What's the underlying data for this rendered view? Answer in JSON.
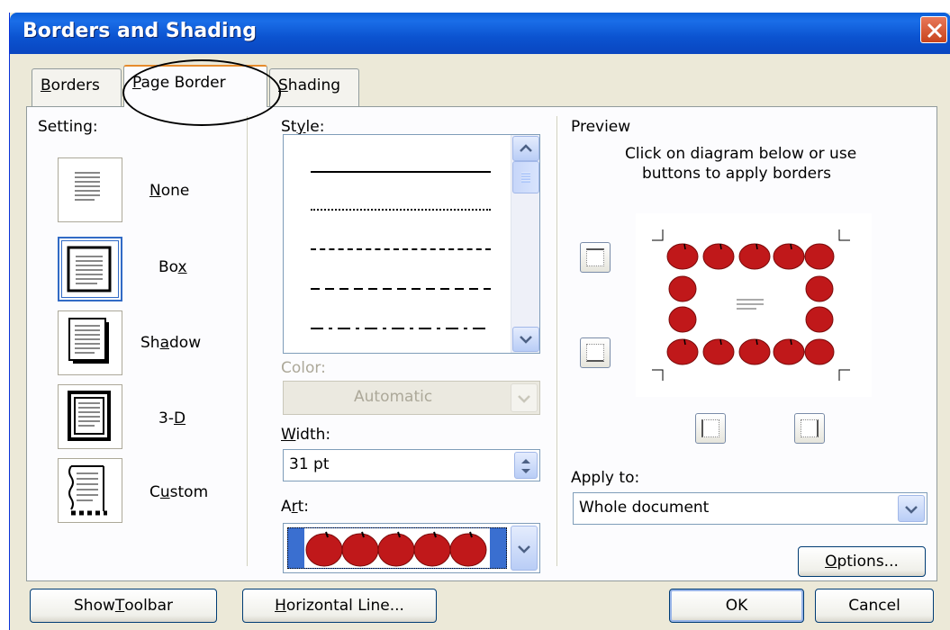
{
  "window": {
    "title": "Borders and Shading"
  },
  "tabs": [
    {
      "label_pre": "",
      "label_u": "B",
      "label_post": "orders"
    },
    {
      "label_pre": "",
      "label_u": "P",
      "label_post": "age Border"
    },
    {
      "label_pre": "",
      "label_u": "S",
      "label_post": "hading"
    }
  ],
  "setting": {
    "label": "Setting:",
    "options": [
      {
        "pre": "",
        "u": "N",
        "post": "one"
      },
      {
        "pre": "Bo",
        "u": "x",
        "post": ""
      },
      {
        "pre": "Sh",
        "u": "a",
        "post": "dow"
      },
      {
        "pre": "3-",
        "u": "D",
        "post": ""
      },
      {
        "pre": "C",
        "u": "u",
        "post": "stom"
      }
    ],
    "selected": "Box"
  },
  "style": {
    "label_pre": "St",
    "label_u": "y",
    "label_post": "le:"
  },
  "color": {
    "label": "Color:",
    "value": "Automatic"
  },
  "width": {
    "label_pre": "",
    "label_u": "W",
    "label_post": "idth:",
    "value": "31 pt"
  },
  "art": {
    "label_pre": "A",
    "label_u": "r",
    "label_post": "t:"
  },
  "preview": {
    "label": "Preview",
    "instruction_line1": "Click on diagram below or use",
    "instruction_line2": "buttons to apply borders"
  },
  "apply_to": {
    "label": "Apply to:",
    "value": "Whole document"
  },
  "buttons": {
    "options": {
      "pre": "",
      "u": "O",
      "post": "ptions..."
    },
    "show_toolbar": {
      "pre": "Show ",
      "u": "T",
      "post": "oolbar"
    },
    "horizontal_line": {
      "pre": "",
      "u": "H",
      "post": "orizontal Line..."
    },
    "ok": "OK",
    "cancel": "Cancel"
  },
  "colors": {
    "accent": "#0a5fd8",
    "art_blue": "#3a6fd0",
    "apple_red": "#c0181a"
  }
}
